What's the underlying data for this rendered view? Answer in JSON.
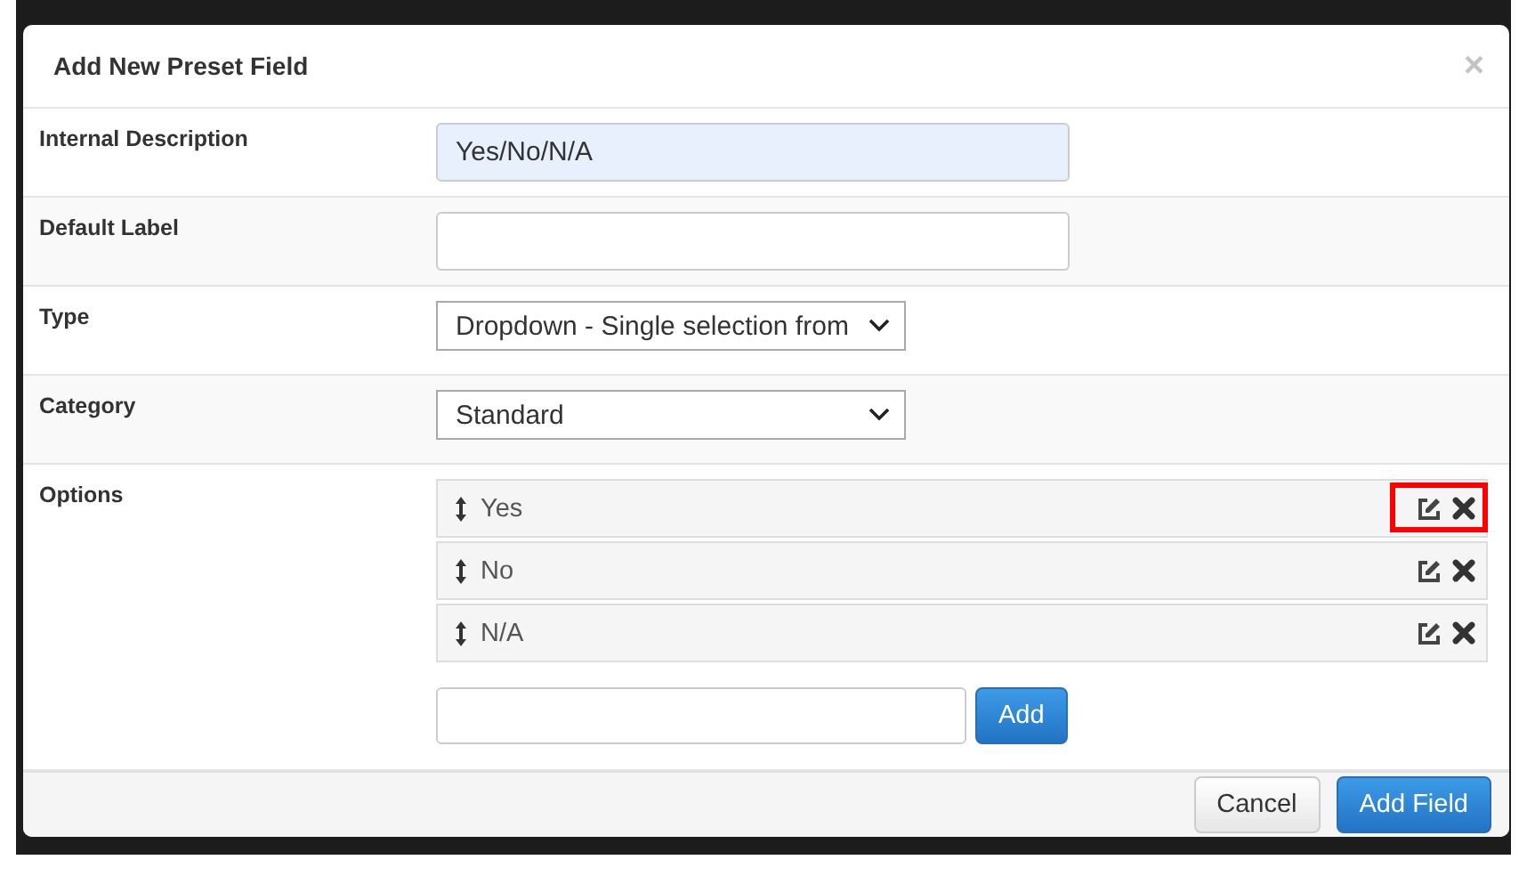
{
  "dialog": {
    "title": "Add New Preset Field",
    "close": "×"
  },
  "fields": [
    {
      "kind": "text",
      "label": "Internal Description",
      "value": "Yes/No/N/A",
      "autofilled": true
    },
    {
      "kind": "text",
      "label": "Default Label",
      "autofilled": false
    },
    {
      "kind": "select",
      "label": "Type",
      "value": "Dropdown - Single selection from"
    },
    {
      "kind": "select",
      "label": "Category",
      "value": "Standard"
    },
    {
      "kind": "options",
      "label": "Options",
      "items": [
        {
          "label": "Yes",
          "highlighted": true
        },
        {
          "label": "No",
          "highlighted": false
        },
        {
          "label": "N/A",
          "highlighted": false
        }
      ],
      "add_button": "Add"
    }
  ],
  "footer": {
    "buttons": [
      {
        "label": "Cancel",
        "primary": false
      },
      {
        "label": "Add Field",
        "primary": true
      }
    ]
  }
}
